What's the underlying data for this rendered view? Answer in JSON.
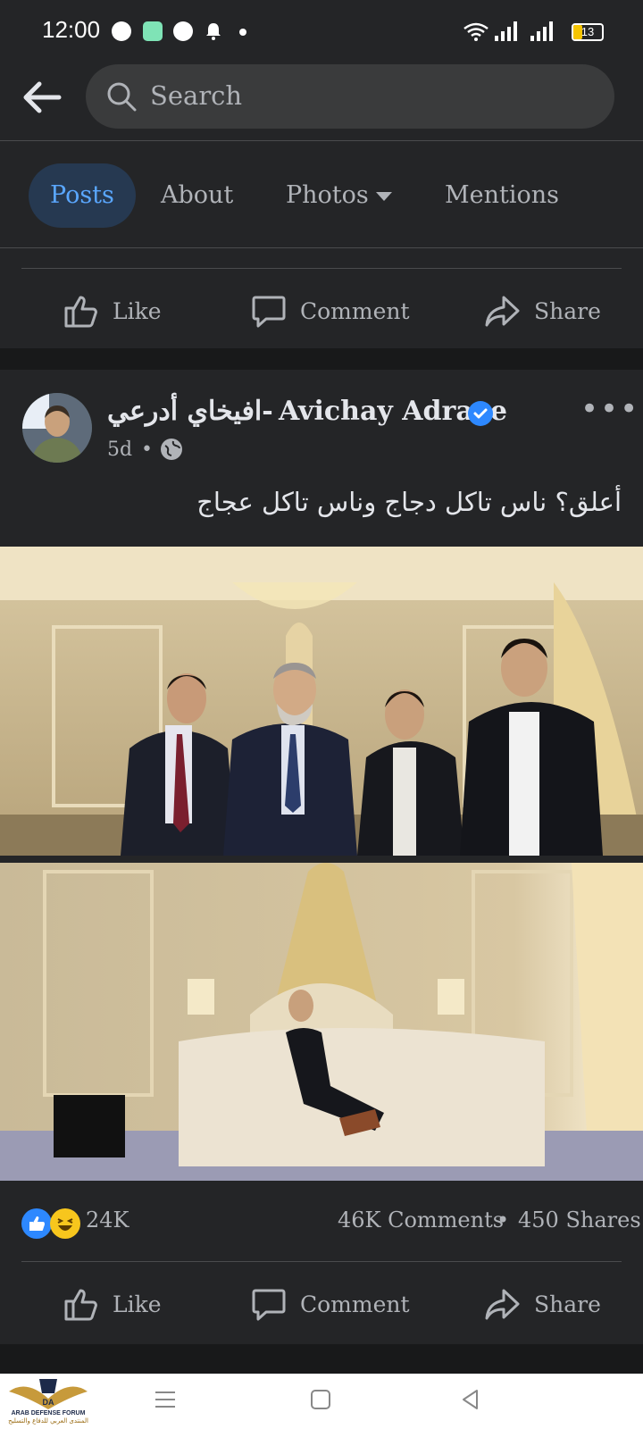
{
  "status_bar": {
    "time": "12:00",
    "battery": "13"
  },
  "search": {
    "placeholder": "Search"
  },
  "tabs": [
    {
      "label": "Posts",
      "active": true
    },
    {
      "label": "About"
    },
    {
      "label": "Photos"
    },
    {
      "label": "Mentions"
    }
  ],
  "actions": {
    "like": "Like",
    "comment": "Comment",
    "share": "Share"
  },
  "post": {
    "author_arabic": "افيخاي أدرعي-",
    "author_latin": "Avichay Adraee",
    "age": "5d",
    "text": "أعلق؟ ناس تاكل دجاج وناس تاكل عجاج",
    "reactions_count": "24K",
    "comments_count": "46K Comments",
    "shares_count": "450 Shares"
  },
  "watermark": {
    "text": "ARAB DEFENSE FORUM",
    "arabic": "المنتدى العربي للدفاع والتسليح"
  },
  "colors": {
    "accent": "#2d88ff",
    "background": "#242527",
    "active_tab_bg": "#263951"
  }
}
